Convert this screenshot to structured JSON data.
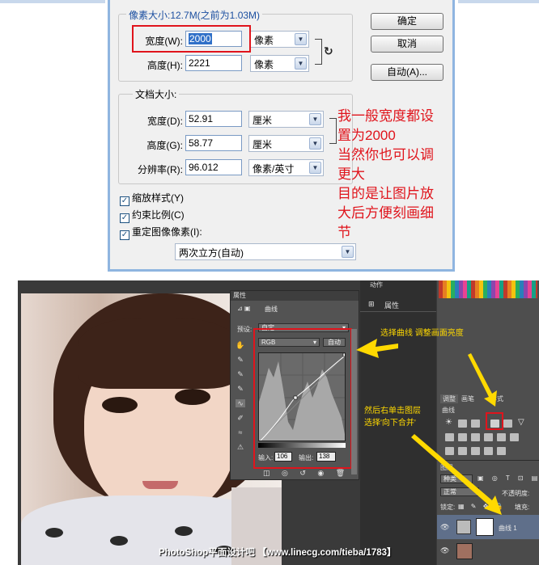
{
  "dialog": {
    "pixel_group": {
      "legend": "像素大小:12.7M(之前为1.03M)",
      "width_label": "宽度(W):",
      "width_value": "2000",
      "width_unit": "像素",
      "height_label": "高度(H):",
      "height_value": "2221",
      "height_unit": "像素"
    },
    "doc_group": {
      "legend": "文档大小:",
      "width_label": "宽度(D):",
      "width_value": "52.91",
      "width_unit": "厘米",
      "height_label": "高度(G):",
      "height_value": "58.77",
      "height_unit": "厘米",
      "res_label": "分辨率(R):",
      "res_value": "96.012",
      "res_unit": "像素/英寸"
    },
    "checkboxes": [
      {
        "label": "缩放样式(Y)",
        "checked": true
      },
      {
        "label": "约束比例(C)",
        "checked": true
      },
      {
        "label": "重定图像像素(I):",
        "checked": true
      }
    ],
    "resample_value": "两次立方(自动)",
    "buttons": {
      "ok": "确定",
      "cancel": "取消",
      "auto": "自动(A)..."
    },
    "annotation_lines": [
      "我一般宽度都设",
      "置为2000",
      "当然你也可以调",
      "更大",
      "目的是让图片放",
      "大后方便刻画细",
      "节"
    ],
    "accent_red": "#e0141c"
  },
  "photoshop": {
    "properties_panel": {
      "title": "属性",
      "subtitle": "曲线",
      "preset_label": "预设:",
      "preset_value": "自定",
      "channel_value": "RGB",
      "auto_button": "自动",
      "input_label": "输入:",
      "input_value": "106",
      "output_label": "输出:",
      "output_value": "138"
    },
    "collapsed_panel": {
      "tab1": "动作",
      "tab2": "属性"
    },
    "right_panel": {
      "tabs": [
        "调整",
        "画笔",
        "样式"
      ],
      "section": "曲线",
      "layers_title": "图层",
      "search_label": "种类",
      "blend_mode": "正常",
      "opacity_label": "不透明度:",
      "lock_label": "锁定:",
      "fill_label": "填充:",
      "layer_name": "曲线 1"
    },
    "annotations": {
      "choose_curve": "选择曲线 调整画面亮度",
      "merge_down_1": "然后右单击图层",
      "merge_down_2": "选择'向下合并'"
    },
    "watermark": "PhotoShop平面设计吧 【www.linecg.com/tieba/1783】",
    "annotation_yellow": "#ffd900"
  }
}
